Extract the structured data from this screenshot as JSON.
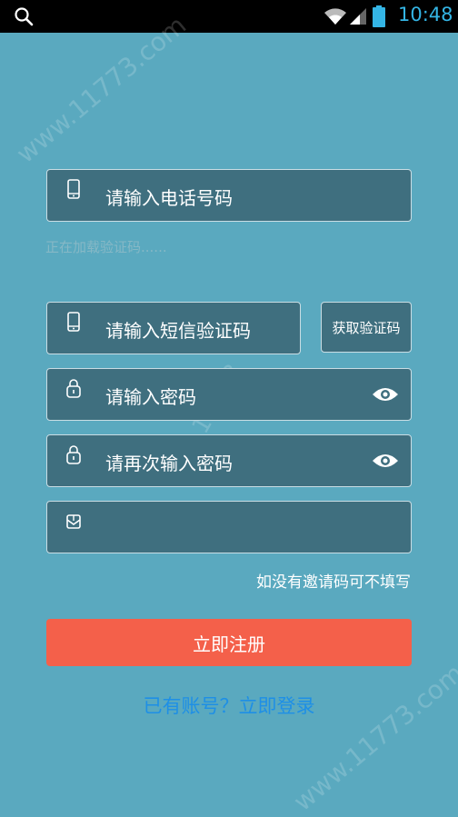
{
  "status_bar": {
    "time": "10:48"
  },
  "form": {
    "phone_placeholder": "请输入电话号码",
    "sms_code_placeholder": "请输入短信验证码",
    "get_code_label": "获取验证码",
    "password_placeholder": "请输入密码",
    "confirm_password_placeholder": "请再次输入密码",
    "invite_code_value": "",
    "invite_note": "如没有邀请码可不填写",
    "register_label": "立即注册",
    "login_link": "已有账号？立即登录"
  },
  "loading_text": "正在加载验证码......",
  "watermark": {
    "text1": "www.11773.com",
    "text2": "11773",
    "text3": "www.11773.com"
  },
  "colors": {
    "background": "#5aa9bf",
    "field_bg": "#3f6f7f",
    "register_button": "#f4604a",
    "login_link": "#1e8fe6",
    "clock": "#34b5e5"
  }
}
